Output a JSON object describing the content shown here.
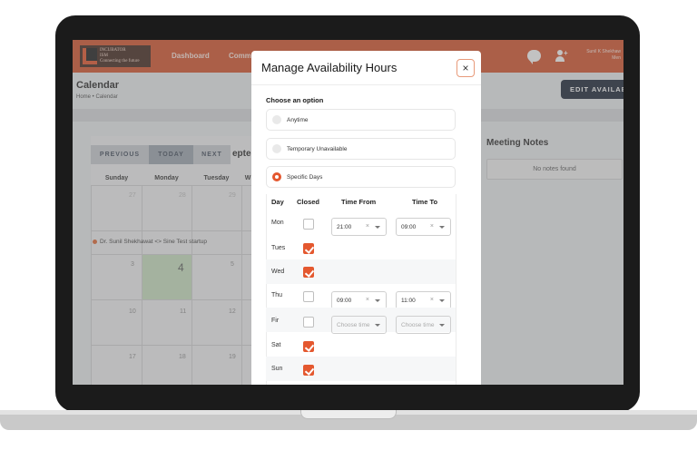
{
  "app": {
    "logo_text_line1": "INCUBATOR",
    "logo_text_line2": "ISM",
    "logo_tagline": "Connecting the future",
    "nav": [
      "Dashboard",
      "Comm"
    ],
    "user_name": "Sunil K Shekhaw",
    "user_role": "Men"
  },
  "page": {
    "title": "Calendar",
    "breadcrumb": "Home • Calendar",
    "edit_button": "EDIT AVAILAB"
  },
  "calendar": {
    "buttons": [
      "PREVIOUS",
      "TODAY",
      "NEXT"
    ],
    "month_label": "epte",
    "day_headers": [
      "Sunday",
      "Monday",
      "Tuesday",
      "W"
    ],
    "row1": [
      "27",
      "28",
      "29"
    ],
    "event": "Dr. Sunil Shekhawat <> Sine Test startup",
    "row2": [
      "3",
      "4",
      "5"
    ],
    "row3": [
      "10",
      "11",
      "12"
    ],
    "row4": [
      "17",
      "18",
      "19"
    ]
  },
  "notes": {
    "title": "Meeting Notes",
    "empty": "No notes found"
  },
  "modal": {
    "title": "Manage Availability Hours",
    "close": "×",
    "choose_label": "Choose an option",
    "options": [
      "Anytime",
      "Temporary Unavailable",
      "Specific Days"
    ],
    "selected_option": "Specific Days",
    "headers": [
      "Day",
      "Closed",
      "Time From",
      "Time To"
    ],
    "rows": [
      {
        "day": "Mon",
        "closed": false,
        "from": "21:00",
        "to": "09:00"
      },
      {
        "day": "Tues",
        "closed": true
      },
      {
        "day": "Wed",
        "closed": true
      },
      {
        "day": "Thu",
        "closed": false,
        "from": "09:00",
        "to": "11:00"
      },
      {
        "day": "Fir",
        "closed": false,
        "from": "Choose time",
        "to": "Choose time"
      },
      {
        "day": "Sat",
        "closed": true
      },
      {
        "day": "Sun",
        "closed": true
      }
    ]
  },
  "colors": {
    "brand": "#d64b22",
    "accent": "#e4582f",
    "dark_button": "#0f1b2c",
    "today": "#c8e2c0"
  }
}
